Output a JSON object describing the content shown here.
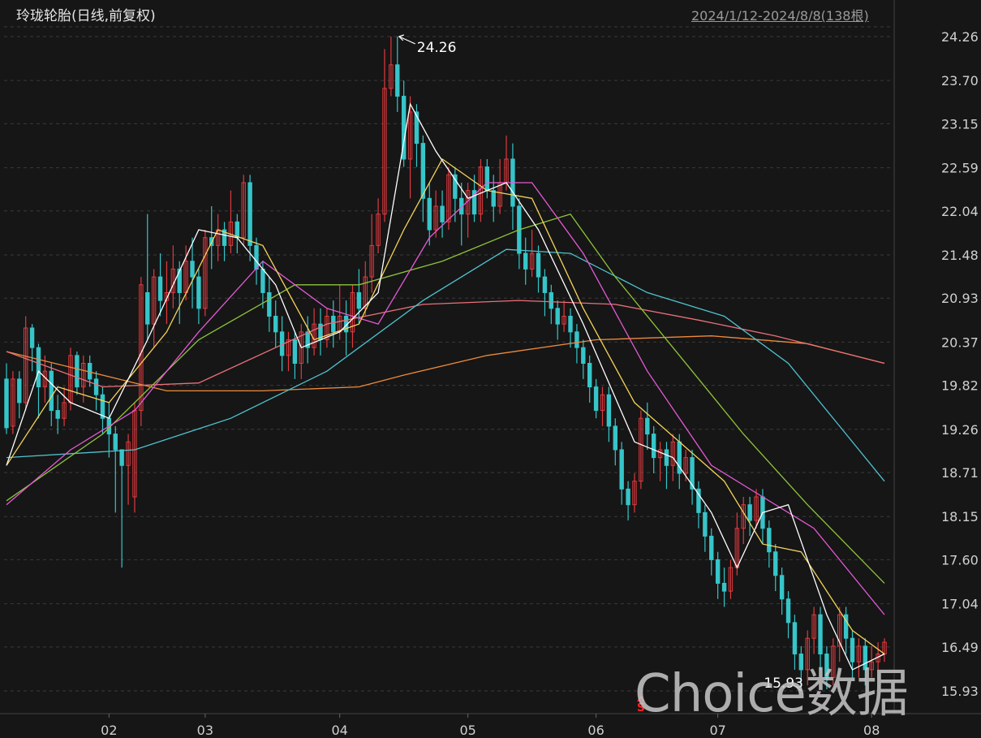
{
  "header": {
    "title": "玲珑轮胎(日线,前复权)",
    "range": "2024/1/12-2024/8/8(138根)"
  },
  "watermark": "Choice数据",
  "colors": {
    "background": "#161616",
    "grid": "#3a3a3a",
    "up": "#e03a3e",
    "down": "#36c5c9",
    "ma5": "#ffffff",
    "ma10": "#f5d45a",
    "ma20": "#e55ad6",
    "ma30": "#8fc43a",
    "ma60": "#4fc3d0",
    "ma120": "#e9707a",
    "ma250": "#f08a3a"
  },
  "chart_data": {
    "type": "candlestick",
    "y_ticks": [
      "24.26",
      "23.70",
      "23.15",
      "22.59",
      "22.04",
      "21.48",
      "20.93",
      "20.37",
      "19.82",
      "19.26",
      "18.71",
      "18.15",
      "17.60",
      "17.04",
      "16.49",
      "15.93"
    ],
    "ylim": [
      15.93,
      24.26
    ],
    "x_ticks": [
      {
        "label": "02",
        "index": 16
      },
      {
        "label": "03",
        "index": 31
      },
      {
        "label": "04",
        "index": 52
      },
      {
        "label": "05",
        "index": 72
      },
      {
        "label": "06",
        "index": 92
      },
      {
        "label": "07",
        "index": 111
      },
      {
        "label": "08",
        "index": 135
      }
    ],
    "annotations": {
      "max_label": "24.26",
      "min_label": "15.93",
      "signal_marker": "S",
      "signal_index": 99
    },
    "candles": [
      [
        19.9,
        19.28,
        20.1,
        19.2
      ],
      [
        19.3,
        19.9,
        20.0,
        19.2
      ],
      [
        19.9,
        19.6,
        20.0,
        19.4
      ],
      [
        19.6,
        20.55,
        20.7,
        19.5
      ],
      [
        20.55,
        20.3,
        20.6,
        20.0
      ],
      [
        20.3,
        19.8,
        20.35,
        19.4
      ],
      [
        19.8,
        20.0,
        20.2,
        19.6
      ],
      [
        20.0,
        19.5,
        20.1,
        19.3
      ],
      [
        19.5,
        19.4,
        19.7,
        19.2
      ],
      [
        19.4,
        19.6,
        19.8,
        19.3
      ],
      [
        19.6,
        20.2,
        20.3,
        19.5
      ],
      [
        20.2,
        19.8,
        20.25,
        19.7
      ],
      [
        19.8,
        20.1,
        20.2,
        19.6
      ],
      [
        20.1,
        19.9,
        20.2,
        19.8
      ],
      [
        19.9,
        19.7,
        20.0,
        19.5
      ],
      [
        19.7,
        19.4,
        19.8,
        19.2
      ],
      [
        19.4,
        19.2,
        19.6,
        18.9
      ],
      [
        19.2,
        19.0,
        19.3,
        18.2
      ],
      [
        19.0,
        18.8,
        19.0,
        17.5
      ],
      [
        18.8,
        19.1,
        19.2,
        18.3
      ],
      [
        18.4,
        19.5,
        19.6,
        18.2
      ],
      [
        19.5,
        21.1,
        21.2,
        19.3
      ],
      [
        21.0,
        20.6,
        22.0,
        20.4
      ],
      [
        20.6,
        21.2,
        21.3,
        20.3
      ],
      [
        21.2,
        20.9,
        21.5,
        20.7
      ],
      [
        20.9,
        21.0,
        21.4,
        20.6
      ],
      [
        21.0,
        21.3,
        21.6,
        20.8
      ],
      [
        21.3,
        21.0,
        21.4,
        20.6
      ],
      [
        21.0,
        21.4,
        21.6,
        20.9
      ],
      [
        21.4,
        21.2,
        21.7,
        20.8
      ],
      [
        21.2,
        20.8,
        21.3,
        20.6
      ],
      [
        20.8,
        21.7,
        21.8,
        20.7
      ],
      [
        21.7,
        21.6,
        22.1,
        21.3
      ],
      [
        21.6,
        21.8,
        22.0,
        21.4
      ],
      [
        21.8,
        21.6,
        21.9,
        21.4
      ],
      [
        21.6,
        21.9,
        22.3,
        21.5
      ],
      [
        21.9,
        21.7,
        22.0,
        21.5
      ],
      [
        21.7,
        22.4,
        22.5,
        21.6
      ],
      [
        22.4,
        21.6,
        22.5,
        21.4
      ],
      [
        21.6,
        21.3,
        21.7,
        21.1
      ],
      [
        21.3,
        21.0,
        21.4,
        20.8
      ],
      [
        21.0,
        20.7,
        21.2,
        20.5
      ],
      [
        20.7,
        20.5,
        20.9,
        20.3
      ],
      [
        20.5,
        20.2,
        20.7,
        20.0
      ],
      [
        20.2,
        20.4,
        20.5,
        20.0
      ],
      [
        20.4,
        20.1,
        20.5,
        19.9
      ],
      [
        20.1,
        20.5,
        20.6,
        19.9
      ],
      [
        20.5,
        20.3,
        20.7,
        20.1
      ],
      [
        20.3,
        20.6,
        20.8,
        20.2
      ],
      [
        20.6,
        20.4,
        20.8,
        20.2
      ],
      [
        20.4,
        20.7,
        20.8,
        20.3
      ],
      [
        20.7,
        20.5,
        20.9,
        20.3
      ],
      [
        20.5,
        20.7,
        21.1,
        20.4
      ],
      [
        20.7,
        20.5,
        20.9,
        20.2
      ],
      [
        20.5,
        21.0,
        21.1,
        20.3
      ],
      [
        21.0,
        20.8,
        21.3,
        20.6
      ],
      [
        20.8,
        21.2,
        21.4,
        20.7
      ],
      [
        21.2,
        21.6,
        22.0,
        21.0
      ],
      [
        21.6,
        22.0,
        22.2,
        21.5
      ],
      [
        22.0,
        23.6,
        24.1,
        21.9
      ],
      [
        23.6,
        23.9,
        24.26,
        23.5
      ],
      [
        23.9,
        23.5,
        24.26,
        23.3
      ],
      [
        23.5,
        22.7,
        23.7,
        22.6
      ],
      [
        22.7,
        23.3,
        23.5,
        22.2
      ],
      [
        23.3,
        22.9,
        23.4,
        22.6
      ],
      [
        22.9,
        22.2,
        23.0,
        21.9
      ],
      [
        22.2,
        21.8,
        22.4,
        21.6
      ],
      [
        21.8,
        22.1,
        22.3,
        21.7
      ],
      [
        22.1,
        21.9,
        22.3,
        21.7
      ],
      [
        21.9,
        22.5,
        22.6,
        21.8
      ],
      [
        22.5,
        22.2,
        22.6,
        21.9
      ],
      [
        22.2,
        22.0,
        22.4,
        21.6
      ],
      [
        22.0,
        22.3,
        22.4,
        21.7
      ],
      [
        22.3,
        22.0,
        22.5,
        21.9
      ],
      [
        22.0,
        22.6,
        22.7,
        21.9
      ],
      [
        22.6,
        22.3,
        22.7,
        22.2
      ],
      [
        22.3,
        22.1,
        22.5,
        21.9
      ],
      [
        22.1,
        22.4,
        22.7,
        22.0
      ],
      [
        22.4,
        22.7,
        23.0,
        22.3
      ],
      [
        22.7,
        22.1,
        22.9,
        21.8
      ],
      [
        22.1,
        21.5,
        22.2,
        21.3
      ],
      [
        21.5,
        21.3,
        21.7,
        21.1
      ],
      [
        21.3,
        21.5,
        21.8,
        21.2
      ],
      [
        21.5,
        21.2,
        21.6,
        21.0
      ],
      [
        21.2,
        21.0,
        21.3,
        20.7
      ],
      [
        21.0,
        20.8,
        21.1,
        20.6
      ],
      [
        20.8,
        20.6,
        20.9,
        20.4
      ],
      [
        20.6,
        20.7,
        20.9,
        20.5
      ],
      [
        20.7,
        20.5,
        20.8,
        20.3
      ],
      [
        20.5,
        20.3,
        20.6,
        20.1
      ],
      [
        20.3,
        20.1,
        20.4,
        19.9
      ],
      [
        20.1,
        19.8,
        20.2,
        19.6
      ],
      [
        19.8,
        19.5,
        19.9,
        19.4
      ],
      [
        19.5,
        19.7,
        19.8,
        19.3
      ],
      [
        19.7,
        19.3,
        19.8,
        19.1
      ],
      [
        19.3,
        19.0,
        19.4,
        18.8
      ],
      [
        19.0,
        18.5,
        19.1,
        18.3
      ],
      [
        18.5,
        18.3,
        18.6,
        18.1
      ],
      [
        18.3,
        18.6,
        18.7,
        18.2
      ],
      [
        18.6,
        19.4,
        19.5,
        18.5
      ],
      [
        19.4,
        19.2,
        19.6,
        19.0
      ],
      [
        19.2,
        18.9,
        19.3,
        18.7
      ],
      [
        18.9,
        19.0,
        19.1,
        18.6
      ],
      [
        19.0,
        18.8,
        19.1,
        18.5
      ],
      [
        18.8,
        19.1,
        19.2,
        18.6
      ],
      [
        19.1,
        18.7,
        19.2,
        18.5
      ],
      [
        18.7,
        18.9,
        19.0,
        18.6
      ],
      [
        18.9,
        18.5,
        19.0,
        18.3
      ],
      [
        18.5,
        18.2,
        18.6,
        18.0
      ],
      [
        18.2,
        17.9,
        18.3,
        17.7
      ],
      [
        17.9,
        17.6,
        18.0,
        17.4
      ],
      [
        17.6,
        17.3,
        17.7,
        17.1
      ],
      [
        17.3,
        17.2,
        17.5,
        17.0
      ],
      [
        17.2,
        17.5,
        17.6,
        17.1
      ],
      [
        17.5,
        18.0,
        18.2,
        17.4
      ],
      [
        18.0,
        18.3,
        18.4,
        17.8
      ],
      [
        18.3,
        18.1,
        18.4,
        17.9
      ],
      [
        18.1,
        18.4,
        18.5,
        18.0
      ],
      [
        18.4,
        18.0,
        18.5,
        17.8
      ],
      [
        18.0,
        17.7,
        18.1,
        17.5
      ],
      [
        17.7,
        17.4,
        17.8,
        17.2
      ],
      [
        17.4,
        17.1,
        17.5,
        16.9
      ],
      [
        17.1,
        16.8,
        17.2,
        16.6
      ],
      [
        16.8,
        16.4,
        16.9,
        16.2
      ],
      [
        16.4,
        16.2,
        16.5,
        15.93
      ],
      [
        16.2,
        16.6,
        16.7,
        16.0
      ],
      [
        16.6,
        16.9,
        17.0,
        16.4
      ],
      [
        16.9,
        16.4,
        17.0,
        16.2
      ],
      [
        16.4,
        16.1,
        16.5,
        15.95
      ],
      [
        16.1,
        16.5,
        16.6,
        16.0
      ],
      [
        16.5,
        16.9,
        17.0,
        16.3
      ],
      [
        16.9,
        16.6,
        17.0,
        16.4
      ],
      [
        16.6,
        16.3,
        16.7,
        16.1
      ],
      [
        16.3,
        16.5,
        16.6,
        16.1
      ],
      [
        16.5,
        16.2,
        16.6,
        16.0
      ],
      [
        16.2,
        16.3,
        16.5,
        16.1
      ],
      [
        16.3,
        16.4,
        16.55,
        16.2
      ],
      [
        16.4,
        16.55,
        16.6,
        16.3
      ]
    ],
    "moving_averages": [
      {
        "name": "MA250",
        "color_key": "ma250",
        "values": [
          [
            0,
            20.25
          ],
          [
            10,
            20.05
          ],
          [
            25,
            19.75
          ],
          [
            40,
            19.75
          ],
          [
            55,
            19.8
          ],
          [
            62,
            19.95
          ],
          [
            75,
            20.2
          ],
          [
            92,
            20.4
          ],
          [
            110,
            20.45
          ],
          [
            125,
            20.35
          ],
          [
            137,
            20.1
          ]
        ]
      },
      {
        "name": "MA120",
        "color_key": "ma120",
        "values": [
          [
            0,
            20.25
          ],
          [
            15,
            19.8
          ],
          [
            30,
            19.85
          ],
          [
            50,
            20.6
          ],
          [
            65,
            20.85
          ],
          [
            80,
            20.9
          ],
          [
            95,
            20.85
          ],
          [
            108,
            20.65
          ],
          [
            120,
            20.45
          ],
          [
            137,
            20.1
          ]
        ]
      },
      {
        "name": "MA60",
        "color_key": "ma60",
        "values": [
          [
            0,
            18.9
          ],
          [
            20,
            19.0
          ],
          [
            35,
            19.4
          ],
          [
            50,
            20.0
          ],
          [
            65,
            20.9
          ],
          [
            78,
            21.55
          ],
          [
            88,
            21.5
          ],
          [
            100,
            21.0
          ],
          [
            112,
            20.7
          ],
          [
            122,
            20.1
          ],
          [
            130,
            19.3
          ],
          [
            137,
            18.6
          ]
        ]
      },
      {
        "name": "MA30",
        "color_key": "ma30",
        "values": [
          [
            0,
            18.35
          ],
          [
            15,
            19.2
          ],
          [
            30,
            20.4
          ],
          [
            45,
            21.1
          ],
          [
            55,
            21.1
          ],
          [
            68,
            21.4
          ],
          [
            80,
            21.8
          ],
          [
            88,
            22.0
          ],
          [
            95,
            21.2
          ],
          [
            105,
            20.2
          ],
          [
            115,
            19.2
          ],
          [
            125,
            18.3
          ],
          [
            137,
            17.3
          ]
        ]
      },
      {
        "name": "MA20",
        "color_key": "ma20",
        "values": [
          [
            0,
            18.3
          ],
          [
            10,
            19.0
          ],
          [
            20,
            19.5
          ],
          [
            30,
            20.5
          ],
          [
            40,
            21.4
          ],
          [
            50,
            20.8
          ],
          [
            58,
            20.6
          ],
          [
            66,
            21.7
          ],
          [
            75,
            22.4
          ],
          [
            82,
            22.4
          ],
          [
            90,
            21.5
          ],
          [
            100,
            20.0
          ],
          [
            110,
            18.8
          ],
          [
            118,
            18.4
          ],
          [
            126,
            18.0
          ],
          [
            137,
            16.9
          ]
        ]
      },
      {
        "name": "MA10",
        "color_key": "ma10",
        "values": [
          [
            0,
            18.8
          ],
          [
            8,
            19.8
          ],
          [
            16,
            19.6
          ],
          [
            25,
            20.5
          ],
          [
            33,
            21.8
          ],
          [
            40,
            21.6
          ],
          [
            48,
            20.4
          ],
          [
            55,
            20.6
          ],
          [
            62,
            21.8
          ],
          [
            68,
            22.7
          ],
          [
            75,
            22.3
          ],
          [
            82,
            22.2
          ],
          [
            90,
            20.8
          ],
          [
            98,
            19.6
          ],
          [
            105,
            19.1
          ],
          [
            112,
            18.6
          ],
          [
            118,
            17.8
          ],
          [
            124,
            17.7
          ],
          [
            132,
            16.7
          ],
          [
            137,
            16.4
          ]
        ]
      },
      {
        "name": "MA5",
        "color_key": "ma5",
        "values": [
          [
            0,
            18.8
          ],
          [
            5,
            20.0
          ],
          [
            10,
            19.6
          ],
          [
            16,
            19.4
          ],
          [
            22,
            20.4
          ],
          [
            30,
            21.8
          ],
          [
            36,
            21.7
          ],
          [
            42,
            21.1
          ],
          [
            46,
            20.3
          ],
          [
            52,
            20.5
          ],
          [
            58,
            21.0
          ],
          [
            63,
            23.4
          ],
          [
            67,
            22.8
          ],
          [
            72,
            22.2
          ],
          [
            78,
            22.4
          ],
          [
            83,
            21.8
          ],
          [
            90,
            20.6
          ],
          [
            98,
            19.1
          ],
          [
            104,
            18.9
          ],
          [
            110,
            18.2
          ],
          [
            114,
            17.5
          ],
          [
            118,
            18.2
          ],
          [
            122,
            18.3
          ],
          [
            128,
            16.9
          ],
          [
            132,
            16.2
          ],
          [
            137,
            16.4
          ]
        ]
      }
    ]
  }
}
